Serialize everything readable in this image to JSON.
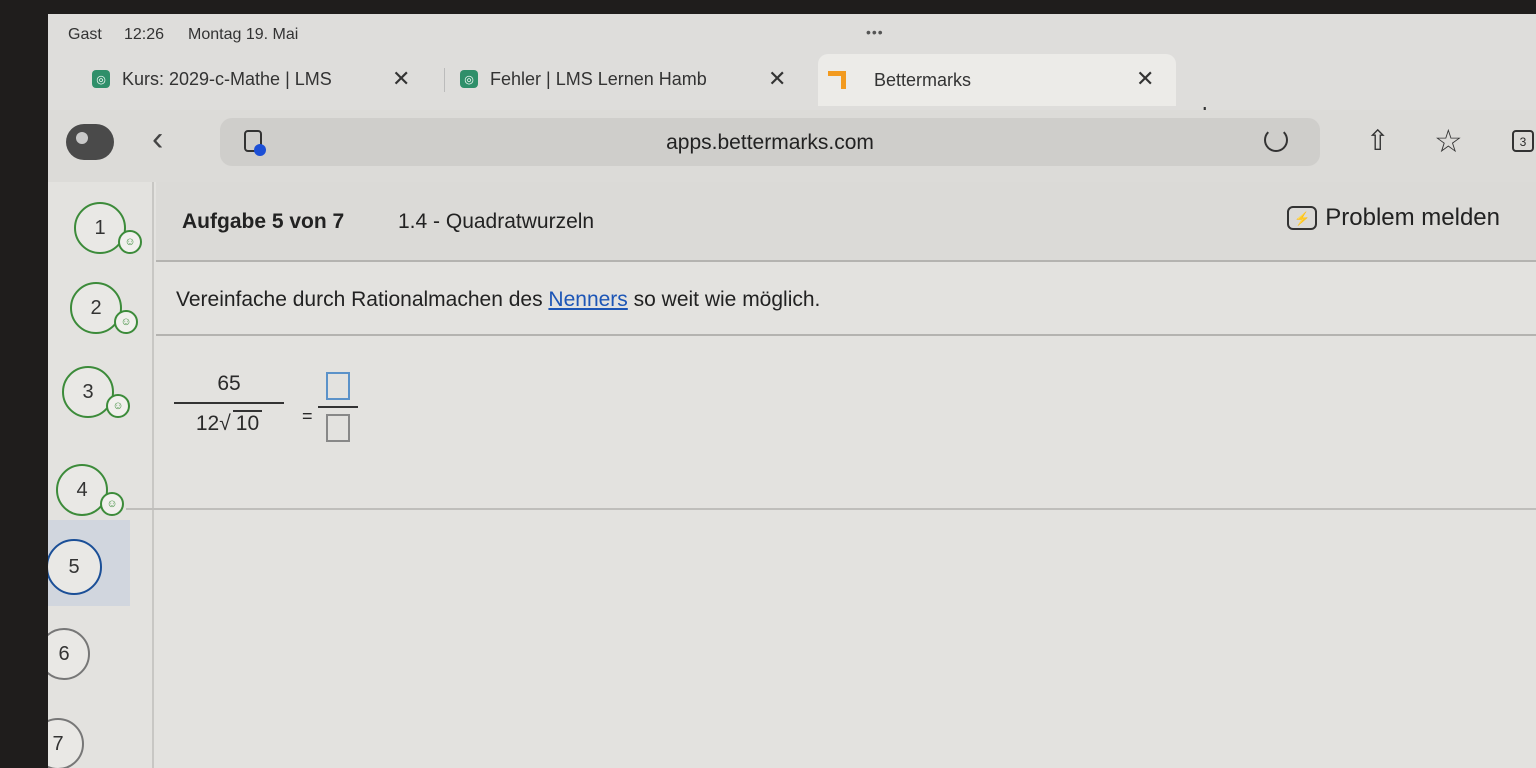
{
  "status_bar": {
    "user": "Gast",
    "time": "12:26",
    "date": "Montag 19. Mai",
    "menu_dots": "•••"
  },
  "tabs": [
    {
      "title": "Kurs: 2029-c-Mathe | LMS",
      "close": "✕"
    },
    {
      "title": "Fehler | LMS Lernen Hamb",
      "close": "✕"
    },
    {
      "title": "Bettermarks",
      "close": "✕"
    }
  ],
  "new_tab": "+",
  "address_bar": {
    "url": "apps.bettermarks.com",
    "back": "‹",
    "share": "⇧",
    "bookmark": "☆",
    "tab_count": "3"
  },
  "steps": [
    {
      "label": "1",
      "state": "done"
    },
    {
      "label": "2",
      "state": "done"
    },
    {
      "label": "3",
      "state": "done"
    },
    {
      "label": "4",
      "state": "done"
    },
    {
      "label": "5",
      "state": "current"
    },
    {
      "label": "6",
      "state": "open"
    },
    {
      "label": "7",
      "state": "open"
    }
  ],
  "smiley": "☺",
  "task": {
    "number_label": "Aufgabe 5 von 7",
    "topic": "1.4 - Quadratwurzeln",
    "report_label": "Problem melden",
    "report_icon": "⚡",
    "instruction_before": "Vereinfache durch Rationalmachen des",
    "instruction_link": "Nenners",
    "instruction_after": "so weit wie möglich."
  },
  "formula": {
    "numerator": "65",
    "denominator_coef": "12",
    "radical_symbol": "√",
    "radicand": "10",
    "equals": "="
  },
  "colors": {
    "step_done": "#3c8b3a",
    "step_current": "#1b4f97",
    "link": "#1c55b6",
    "brand": "#f29a1f"
  }
}
